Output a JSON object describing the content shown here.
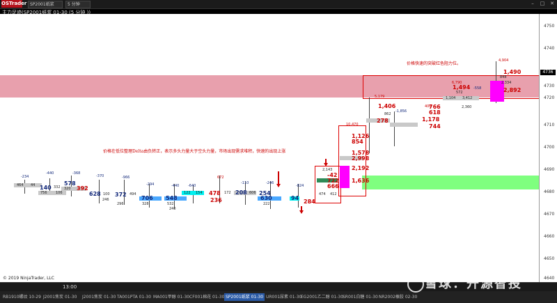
{
  "window": {
    "brand": "OSTrader",
    "instrument_select": "SP2001纸浆",
    "period_select": "5 分钟",
    "chart_label": "主力足迹(SP2001纸浆 01-30 (5 分钟 ))"
  },
  "price_axis": {
    "ticks": [
      "4750",
      "4740",
      "4730",
      "4720",
      "4710",
      "4700",
      "4690",
      "4680",
      "4670",
      "4660",
      "4650",
      "4640"
    ],
    "current_price": "4736"
  },
  "annotations": {
    "top_note": "价格快速的突破红色阻力位。",
    "mid_note": "价格在低位整理Delta由负转正，表示多头力量大于空头力量，市场出现需求堆积，快速的出现上涨"
  },
  "footprint_values": {
    "c1": [
      "-234",
      "0",
      "6",
      "464",
      "44"
    ],
    "c2": [
      "-440",
      "140",
      "332",
      "756",
      "106"
    ],
    "c3": [
      "-368",
      "578",
      "320",
      "392",
      "172",
      "34",
      "16"
    ],
    "c4": [
      "-370",
      "628",
      "100",
      "116",
      "246",
      "0"
    ],
    "c5": [
      "-966",
      "372",
      "494",
      "296",
      "0"
    ],
    "c6": [
      "-294",
      "706",
      "328",
      "26",
      "0"
    ],
    "c7": [
      "-440",
      "548",
      "532",
      "240",
      "12"
    ],
    "c8": [
      "-640",
      "122",
      "154",
      "82",
      "0"
    ],
    "c9": [
      "672",
      "478",
      "172",
      "236",
      "12"
    ],
    "c10": [
      "-110",
      "208",
      "606",
      "72",
      "0"
    ],
    "c11": [
      "-246",
      "254",
      "630",
      "222",
      "0"
    ],
    "c12": [
      "-824",
      "94",
      "284",
      "366",
      "0"
    ],
    "c13": [
      "-42",
      "722",
      "666",
      "688",
      "1,636",
      "2,192",
      "474",
      "412",
      "2,143"
    ],
    "c14": [
      "10,470",
      "1,126",
      "854",
      "1,578",
      "2,998",
      "542"
    ],
    "c15": [
      "5,179",
      "1,406",
      "278",
      "862",
      "1,752",
      "1,672"
    ],
    "c16": [
      "-1,856",
      "618",
      "1,178",
      "766",
      "744",
      "406"
    ],
    "c17": [
      "6,790",
      "1,494",
      "572",
      "1,104",
      "3,412",
      "2,360",
      "-558"
    ],
    "c18": [
      "4,904",
      "1,490",
      "2,892",
      "2,334",
      "848"
    ]
  },
  "copyright": "© 2019 NinjaTrader, LLC",
  "time_label": "13:00",
  "tabs": [
    "RB1910螺纹 10-29",
    "J2001焦炭 01-30",
    "J2001焦炭 01-30",
    "TA001PTA 01-30",
    "MA001甲醇 01-30",
    "CF001棉花 01-30",
    "SP2001纸浆 01-30",
    "UR001尿素 01-30",
    "EG2001乙二醇 01-30",
    "SR001白糖 01-30",
    "NR2002橡胶 02-30"
  ],
  "watermark": "雪球：开源智投",
  "colors": {
    "resistance_zone": "#e8a0ad",
    "support_zone": "#7fff7f",
    "box": "#dd0000"
  }
}
